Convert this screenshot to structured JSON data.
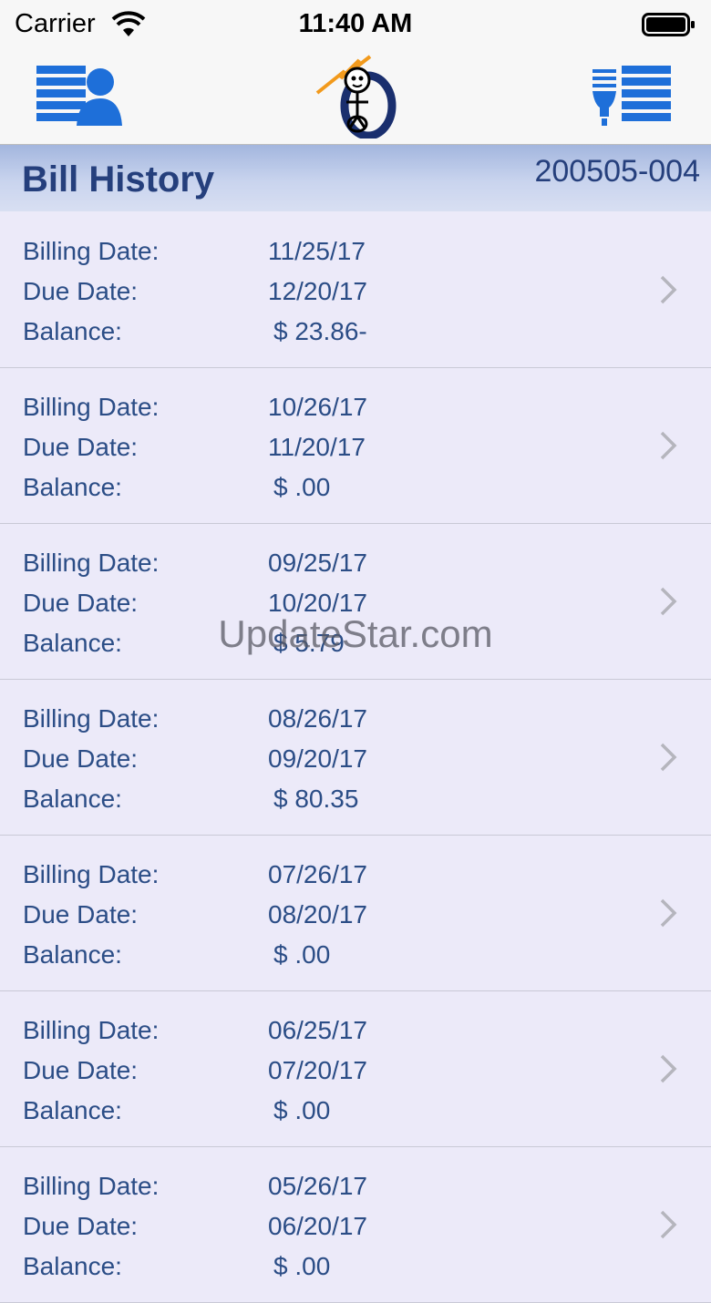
{
  "status_bar": {
    "carrier": "Carrier",
    "time": "11:40 AM"
  },
  "nav": {
    "profile_icon": "account-profile-icon",
    "logo_icon": "utility-mascot-logo",
    "bills_icon": "bill-list-icon"
  },
  "header": {
    "title": "Bill History",
    "account": "200505-004"
  },
  "labels": {
    "billing": "Billing Date:",
    "due": "Due Date:",
    "balance": "Balance:"
  },
  "bills": [
    {
      "billing_date": "11/25/17",
      "due_date": "12/20/17",
      "balance": "$ 23.86-"
    },
    {
      "billing_date": "10/26/17",
      "due_date": "11/20/17",
      "balance": "$ .00"
    },
    {
      "billing_date": "09/25/17",
      "due_date": "10/20/17",
      "balance": "$ 5.79"
    },
    {
      "billing_date": "08/26/17",
      "due_date": "09/20/17",
      "balance": "$ 80.35"
    },
    {
      "billing_date": "07/26/17",
      "due_date": "08/20/17",
      "balance": "$ .00"
    },
    {
      "billing_date": "06/25/17",
      "due_date": "07/20/17",
      "balance": "$ .00"
    },
    {
      "billing_date": "05/26/17",
      "due_date": "06/20/17",
      "balance": "$ .00"
    }
  ],
  "watermark": "UpdateStar.com",
  "colors": {
    "accent": "#1E6FD9",
    "text": "#2B4D86",
    "title": "#253F7C",
    "background": "#ECEAF9"
  }
}
